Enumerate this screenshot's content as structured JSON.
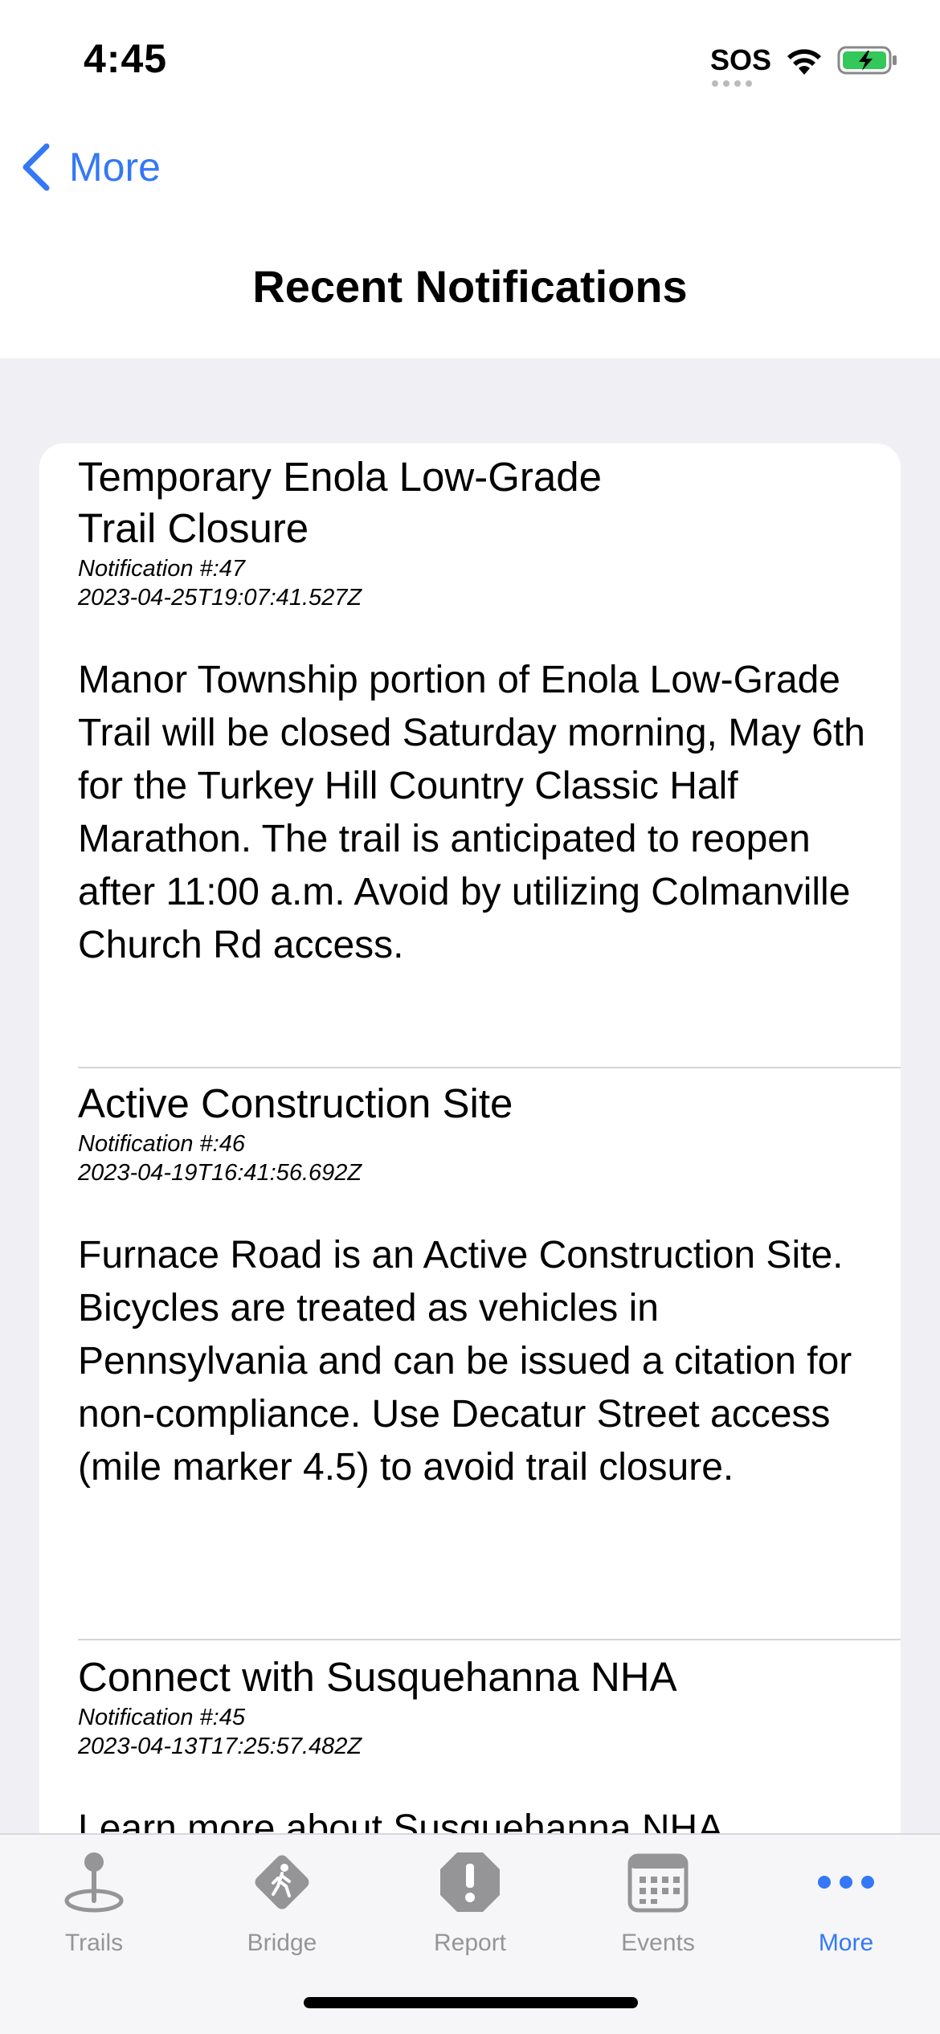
{
  "status_bar": {
    "time": "4:45",
    "sos": "SOS"
  },
  "nav": {
    "back_label": "More",
    "title": "Recent Notifications"
  },
  "notifications": [
    {
      "title_line1": "Temporary Enola Low-Grade",
      "title_line2": "Trail Closure",
      "number": "Notification #:47",
      "timestamp": "2023-04-25T19:07:41.527Z",
      "body": "Manor Township portion of Enola Low-Grade Trail will be closed Saturday morning, May 6th for the Turkey Hill Country Classic Half Marathon. The trail is anticipated to reopen after 11:00 a.m. Avoid by utilizing Colmanville Church Rd access."
    },
    {
      "title_line1": "Active Construction Site",
      "number": "Notification #:46",
      "timestamp": "2023-04-19T16:41:56.692Z",
      "body": "Furnace Road is an Active Construction Site. Bicycles are treated as vehicles in Pennsylvania and can be issued a citation for non-compliance. Use Decatur Street access (mile marker 4.5) to avoid trail closure."
    },
    {
      "title_line1": "Connect with Susquehanna NHA",
      "number": "Notification #:45",
      "timestamp": "2023-04-13T17:25:57.482Z",
      "body": "Learn more about Susquehanna NHA"
    }
  ],
  "tabs": [
    {
      "label": "Trails",
      "icon": "map-pin-icon"
    },
    {
      "label": "Bridge",
      "icon": "hiker-sign-icon"
    },
    {
      "label": "Report",
      "icon": "exclamation-octagon-icon"
    },
    {
      "label": "Events",
      "icon": "calendar-icon"
    },
    {
      "label": "More",
      "icon": "ellipsis-icon",
      "active": true
    }
  ],
  "colors": {
    "accent": "#3478f6",
    "inactive_tab": "#959598",
    "background": "#efeff4",
    "battery": "#34c759"
  }
}
